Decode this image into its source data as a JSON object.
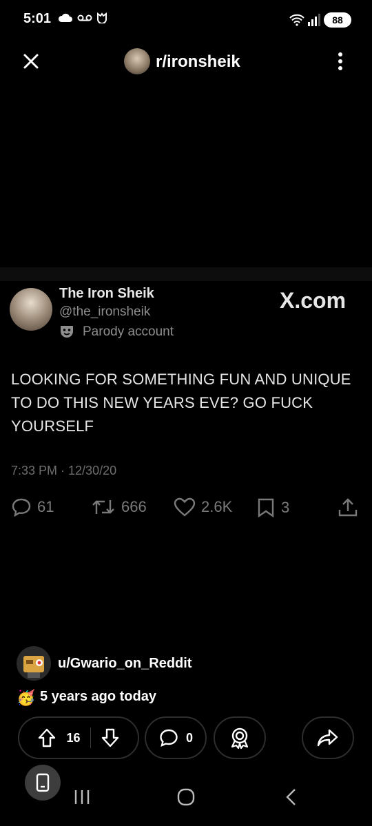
{
  "status_bar": {
    "time": "5:01",
    "battery": "88"
  },
  "header": {
    "title": "r/ironsheik"
  },
  "tweet": {
    "name": "The Iron Sheik",
    "handle": "@the_ironsheik",
    "badge": "Parody account",
    "source": "X.com",
    "text": "LOOKING FOR SOMETHING FUN AND UNIQUE TO DO THIS NEW YEARS EVE? GO FUCK YOURSELF",
    "timestamp": "7:33 PM · 12/30/20",
    "replies": "61",
    "retweets": "666",
    "likes": "2.6K",
    "bookmarks": "3"
  },
  "post": {
    "username": "u/Gwario_on_Reddit",
    "anniversary": "5 years ago today",
    "votes": "16",
    "comments": "0"
  }
}
